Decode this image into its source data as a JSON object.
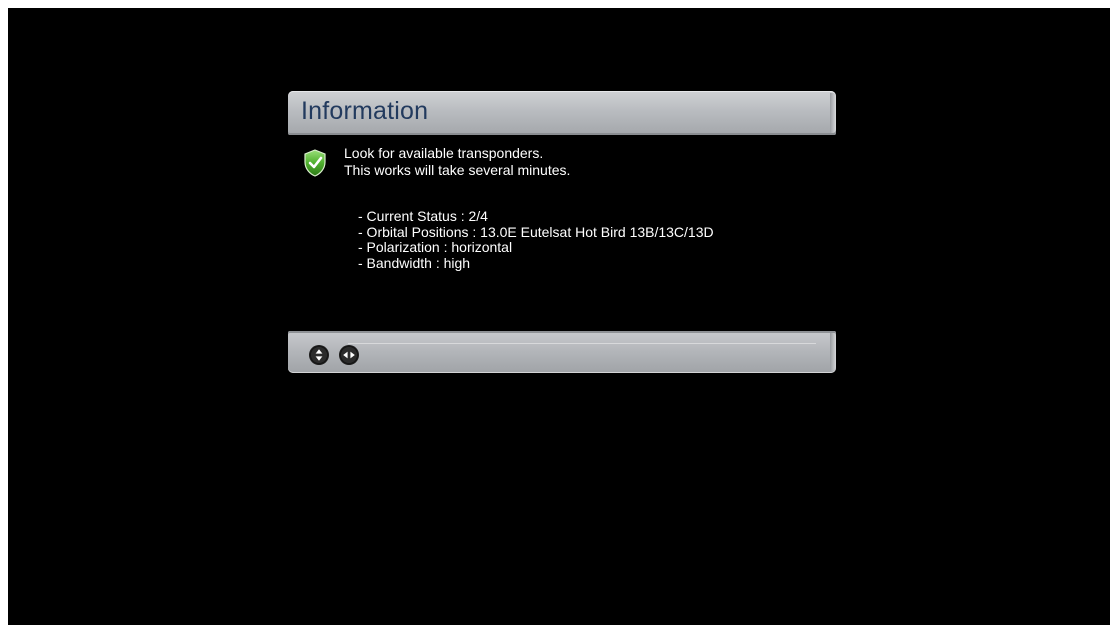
{
  "dialog": {
    "title": "Information",
    "message_lines": [
      "Look for available transponders.",
      "This works will take several minutes."
    ],
    "details": [
      "- Current Status : 2/4",
      "- Orbital Positions : 13.0E Eutelsat Hot Bird 13B/13C/13D",
      "- Polarization : horizontal",
      "- Bandwidth : high"
    ],
    "icon": "shield-check-icon"
  },
  "footer": {
    "buttons": [
      "up-down-navigation-icon",
      "left-right-navigation-icon"
    ]
  },
  "colors": {
    "background": "#000000",
    "title_text": "#223a5e",
    "shield_green": "#5cbf3a"
  }
}
